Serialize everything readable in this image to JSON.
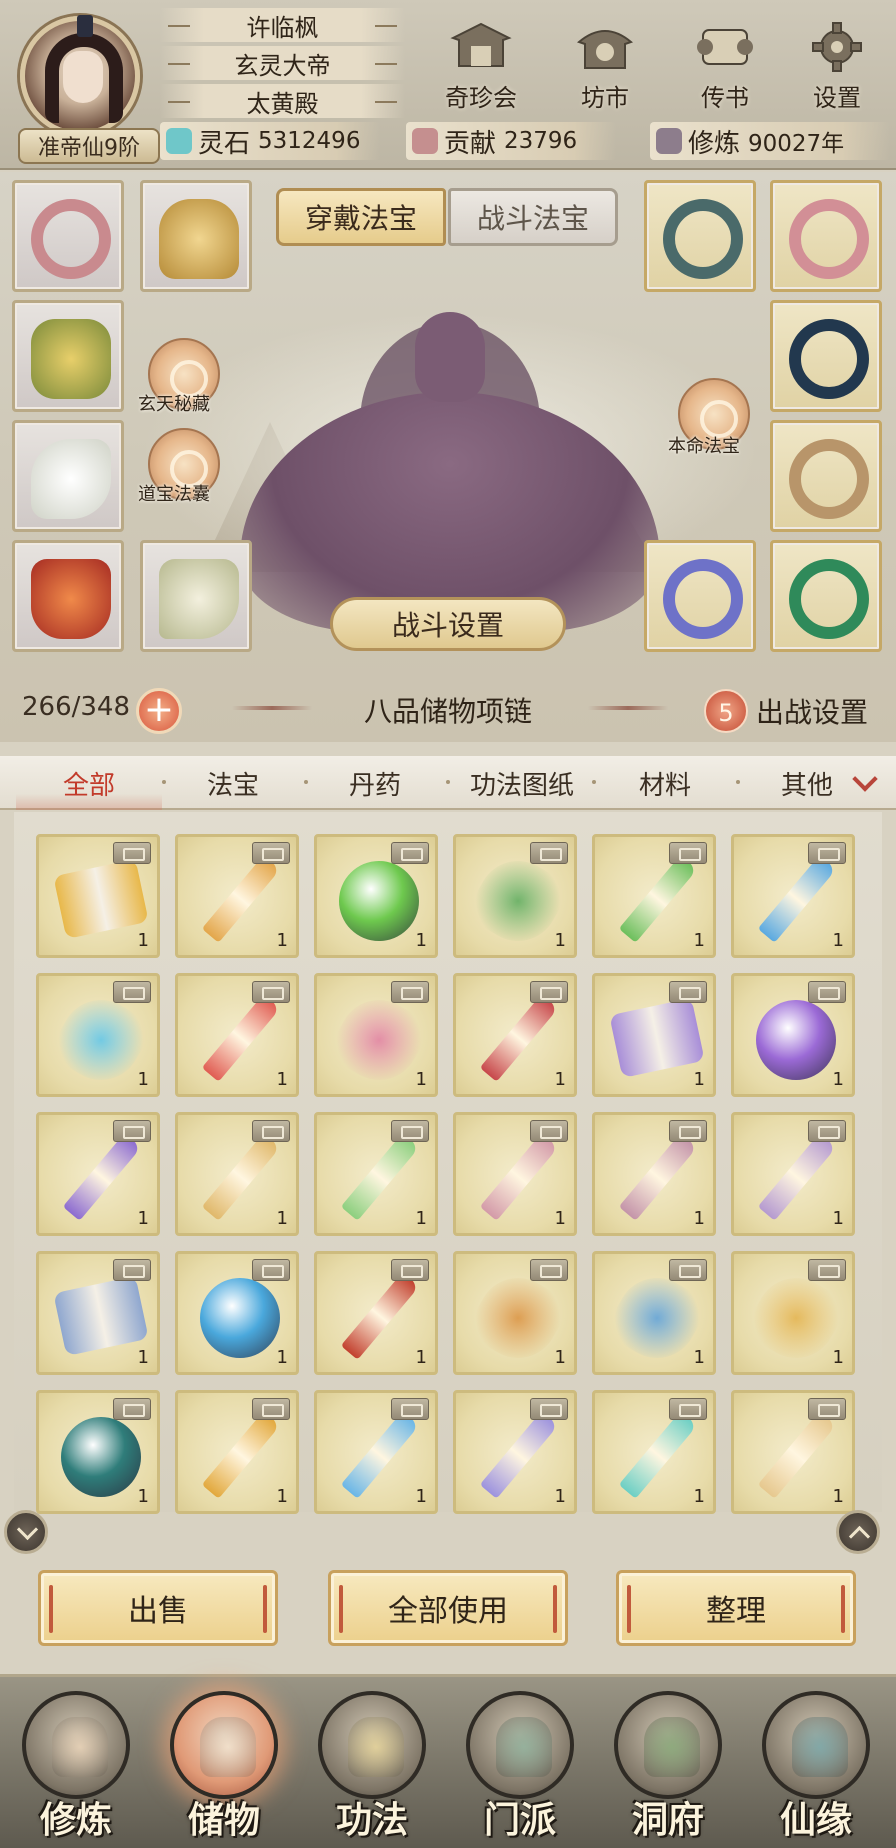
{
  "player": {
    "name": "许临枫",
    "title": "玄灵大帝",
    "sect": "太黄殿",
    "realm": "准帝仙9阶"
  },
  "top_menu": [
    {
      "label": "奇珍会",
      "icon": "treasure-pavilion-icon"
    },
    {
      "label": "坊市",
      "icon": "market-icon"
    },
    {
      "label": "传书",
      "icon": "letter-scroll-icon"
    },
    {
      "label": "设置",
      "icon": "gear-icon"
    }
  ],
  "resources": {
    "spirit_stone": {
      "label": "灵石",
      "value": "5312496",
      "color": "#6fc7c9"
    },
    "contribution": {
      "label": "贡献",
      "value": "23796",
      "color": "#c58f8f"
    },
    "cultivation": {
      "label": "修炼",
      "value": "90027年",
      "color": "#8d7d8c"
    }
  },
  "equip_tabs": {
    "wear": "穿戴法宝",
    "battle": "战斗法宝",
    "active": "wear"
  },
  "equipment_skills": {
    "xuantian": "玄天秘藏",
    "daobao": "道宝法囊",
    "benming": "本命法宝"
  },
  "battle_settings_button": "战斗设置",
  "bag": {
    "capacity": "266/348",
    "title": "八品储物项链",
    "deploy_count": "5",
    "deploy_label": "出战设置"
  },
  "categories": [
    {
      "label": "全部",
      "active": true
    },
    {
      "label": "法宝"
    },
    {
      "label": "丹药"
    },
    {
      "label": "功法图纸"
    },
    {
      "label": "材料"
    },
    {
      "label": "其他"
    }
  ],
  "items": [
    {
      "name": "golden-lantern",
      "qty": "1",
      "kind": "scroll",
      "color": "#e8b84a"
    },
    {
      "name": "golden-axe",
      "qty": "1",
      "kind": "blade",
      "color": "#e3a64a"
    },
    {
      "name": "green-orb",
      "qty": "1",
      "kind": "orb",
      "color": "#6ec94e"
    },
    {
      "name": "green-umbrella",
      "qty": "1",
      "kind": "wisp",
      "color": "#5aaa5a"
    },
    {
      "name": "green-dagger",
      "qty": "1",
      "kind": "blade",
      "color": "#6cbf5c"
    },
    {
      "name": "blue-sabre",
      "qty": "1",
      "kind": "blade",
      "color": "#5aa9e0"
    },
    {
      "name": "azure-ribbon",
      "qty": "1",
      "kind": "wisp",
      "color": "#5cc4e8"
    },
    {
      "name": "crimson-sword",
      "qty": "1",
      "kind": "blade",
      "color": "#e05c52"
    },
    {
      "name": "pink-whip",
      "qty": "1",
      "kind": "wisp",
      "color": "#e07ea0"
    },
    {
      "name": "red-blade",
      "qty": "1",
      "kind": "blade",
      "color": "#c7474a"
    },
    {
      "name": "violet-scroll",
      "qty": "1",
      "kind": "scroll",
      "color": "#a88ed8"
    },
    {
      "name": "purple-orb",
      "qty": "1",
      "kind": "orb",
      "color": "#9b6ad6"
    },
    {
      "name": "violet-sword",
      "qty": "1",
      "kind": "blade",
      "color": "#8c6bd0"
    },
    {
      "name": "gold-flying-sword",
      "qty": "1",
      "kind": "blade",
      "color": "#e0b86a"
    },
    {
      "name": "jade-flying-sword",
      "qty": "1",
      "kind": "blade",
      "color": "#8ccf7e"
    },
    {
      "name": "rose-flying-sword",
      "qty": "1",
      "kind": "blade",
      "color": "#d39aa8"
    },
    {
      "name": "mauve-flying-sword",
      "qty": "1",
      "kind": "blade",
      "color": "#c494a9"
    },
    {
      "name": "lilac-flying-sword",
      "qty": "1",
      "kind": "blade",
      "color": "#b59ad0"
    },
    {
      "name": "thunder-scroll",
      "qty": "1",
      "kind": "scroll",
      "color": "#8fa7cf"
    },
    {
      "name": "blue-orb",
      "qty": "1",
      "kind": "orb",
      "color": "#4aa8dc"
    },
    {
      "name": "flame-blade",
      "qty": "1",
      "kind": "blade",
      "color": "#c2402e"
    },
    {
      "name": "amber-hatchet",
      "qty": "1",
      "kind": "wisp",
      "color": "#d9913e"
    },
    {
      "name": "blue-ribbon",
      "qty": "1",
      "kind": "wisp",
      "color": "#5a9fd8"
    },
    {
      "name": "golden-sickle",
      "qty": "1",
      "kind": "wisp",
      "color": "#e2b14a"
    },
    {
      "name": "teal-mirror",
      "qty": "1",
      "kind": "orb",
      "color": "#2f7d7a"
    },
    {
      "name": "golden-longsword",
      "qty": "1",
      "kind": "blade",
      "color": "#e2a83c"
    },
    {
      "name": "ice-sword",
      "qty": "1",
      "kind": "blade",
      "color": "#6ab6e6"
    },
    {
      "name": "spirit-sword",
      "qty": "1",
      "kind": "blade",
      "color": "#9c92de"
    },
    {
      "name": "aqua-flying-sword",
      "qty": "1",
      "kind": "blade",
      "color": "#6ccfc4"
    },
    {
      "name": "sand-flying-sword",
      "qty": "1",
      "kind": "blade",
      "color": "#e6c88e"
    }
  ],
  "actions": {
    "sell": "出售",
    "use_all": "全部使用",
    "sort": "整理"
  },
  "nav": [
    {
      "label": "修炼",
      "icon": "cultivation-icon",
      "tint": "#e9d3b8"
    },
    {
      "label": "储物",
      "icon": "storage-bag-icon",
      "tint": "#f1e3cf",
      "active": true
    },
    {
      "label": "功法",
      "icon": "scroll-book-icon",
      "tint": "#e6d49a"
    },
    {
      "label": "门派",
      "icon": "sect-gate-icon",
      "tint": "#8fb09b"
    },
    {
      "label": "洞府",
      "icon": "cave-mansion-icon",
      "tint": "#87a878"
    },
    {
      "label": "仙缘",
      "icon": "fate-swirl-icon",
      "tint": "#78a6a8"
    }
  ]
}
